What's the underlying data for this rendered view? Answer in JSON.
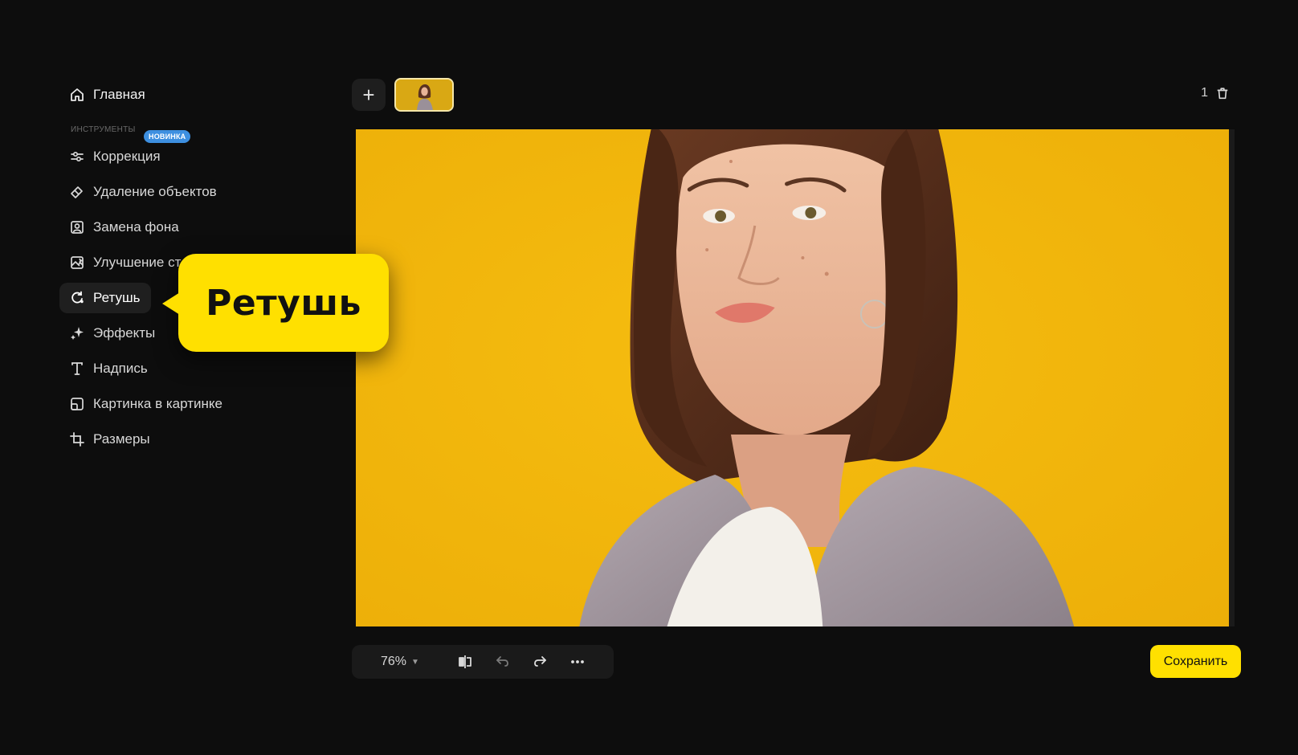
{
  "sidebar": {
    "home_label": "Главная",
    "section_label": "ИНСТРУМЕНТЫ",
    "items": [
      {
        "label": "Коррекция",
        "icon": "sliders-icon",
        "badge": "НОВИНКА"
      },
      {
        "label": "Удаление объектов",
        "icon": "eraser-icon"
      },
      {
        "label": "Замена фона",
        "icon": "portrait-icon"
      },
      {
        "label": "Улучшение ст",
        "icon": "image-enhance-icon"
      },
      {
        "label": "Ретушь",
        "icon": "retouch-icon",
        "active": true
      },
      {
        "label": "Эффекты",
        "icon": "sparkle-icon"
      },
      {
        "label": "Надпись",
        "icon": "text-icon"
      },
      {
        "label": "Картинка в картинке",
        "icon": "picture-in-picture-icon"
      },
      {
        "label": "Размеры",
        "icon": "crop-icon"
      }
    ]
  },
  "callout": {
    "text": "Ретушь"
  },
  "topbar": {
    "add_icon": "plus-icon",
    "count": "1",
    "trash_icon": "trash-icon"
  },
  "toolbar": {
    "zoom": "76%",
    "icons": [
      "compare-icon",
      "undo-icon",
      "redo-icon",
      "more-icon"
    ],
    "save_label": "Сохранить"
  },
  "colors": {
    "background": "#0d0d0d",
    "accent": "#ffe000",
    "badge": "#3d8fe0",
    "canvas": "#f2b40a"
  }
}
